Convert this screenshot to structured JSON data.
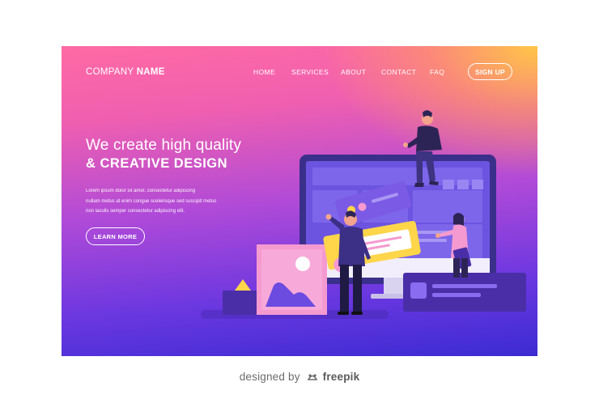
{
  "nav": {
    "logo_regular": "COMPANY ",
    "logo_bold": "NAME",
    "links": [
      "HOME",
      "SERVICES",
      "ABOUT",
      "CONTACT",
      "FAQ"
    ],
    "signup_label": "SIGN UP"
  },
  "hero": {
    "line1": "We create high quality",
    "line2": "& CREATIVE DESIGN",
    "body_lines": [
      "Lorem ipsum dolor sit amet, consectetur adipiscing",
      "nullam metus at enim congue scelerisque sed suscipit metus",
      "non iaculis semper consectetur adipiscing elit."
    ],
    "cta_label": "LEARN MORE"
  },
  "illustration": {
    "name": "website-building-team",
    "colors": {
      "monitor_frame": "#3a2f8a",
      "monitor_screen": "#6c54e0",
      "panel_purple": "#7b5ae6",
      "panel_yellow": "#ffd54a",
      "photo_card": "#f59ad0",
      "dark_block": "#4a2ea8"
    }
  },
  "credit": {
    "prefix": "designed by",
    "brand": "freepik"
  }
}
